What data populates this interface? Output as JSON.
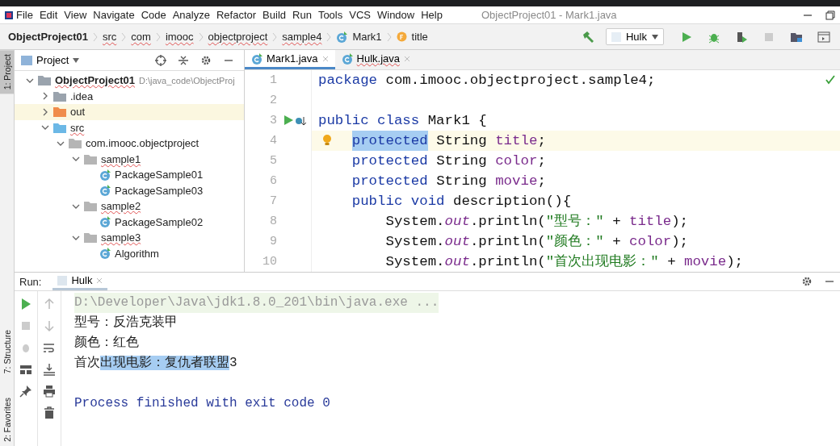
{
  "window": {
    "title": "ObjectProject01 - Mark1.java"
  },
  "menu": [
    "File",
    "Edit",
    "View",
    "Navigate",
    "Code",
    "Analyze",
    "Refactor",
    "Build",
    "Run",
    "Tools",
    "VCS",
    "Window",
    "Help"
  ],
  "breadcrumbs": [
    {
      "label": "ObjectProject01",
      "kind": "project"
    },
    {
      "label": "src",
      "kind": "dir"
    },
    {
      "label": "com",
      "kind": "dir"
    },
    {
      "label": "imooc",
      "kind": "dir"
    },
    {
      "label": "objectproject",
      "kind": "dir"
    },
    {
      "label": "sample4",
      "kind": "dir"
    },
    {
      "label": "Mark1",
      "kind": "class"
    },
    {
      "label": "title",
      "kind": "field"
    }
  ],
  "run_config": {
    "label": "Hulk"
  },
  "side_tabs": [
    {
      "label": "1: Project",
      "selected": true
    },
    {
      "label": "7: Structure",
      "selected": false
    },
    {
      "label": "2: Favorites",
      "selected": false
    }
  ],
  "project_panel": {
    "title": "Project",
    "tree": [
      {
        "label": "ObjectProject01",
        "path": "D:\\java_code\\ObjectProj",
        "kind": "module",
        "expanded": true,
        "selected": false,
        "children": [
          {
            "label": ".idea",
            "kind": "folder",
            "expanded": false,
            "selected": false
          },
          {
            "label": "out",
            "kind": "excluded",
            "expanded": false,
            "selected": true
          },
          {
            "label": "src",
            "kind": "source",
            "expanded": true,
            "selected": false,
            "children": [
              {
                "label": "com.imooc.objectproject",
                "kind": "package",
                "expanded": true,
                "selected": false,
                "children": [
                  {
                    "label": "sample1",
                    "kind": "package",
                    "expanded": true,
                    "selected": false,
                    "children": [
                      {
                        "label": "PackageSample01",
                        "kind": "class",
                        "selected": false
                      },
                      {
                        "label": "PackageSample03",
                        "kind": "class",
                        "selected": false
                      }
                    ]
                  },
                  {
                    "label": "sample2",
                    "kind": "package",
                    "expanded": true,
                    "selected": false,
                    "children": [
                      {
                        "label": "PackageSample02",
                        "kind": "class",
                        "selected": false
                      }
                    ]
                  },
                  {
                    "label": "sample3",
                    "kind": "package",
                    "expanded": true,
                    "selected": false,
                    "children": [
                      {
                        "label": "Algorithm",
                        "kind": "class",
                        "selected": false
                      }
                    ]
                  }
                ]
              }
            ]
          }
        ]
      }
    ]
  },
  "editor_tabs": [
    {
      "label": "Mark1.java",
      "selected": true
    },
    {
      "label": "Hulk.java",
      "selected": false
    }
  ],
  "code": [
    {
      "number": "1",
      "kind": "plain",
      "current": false,
      "tokens": [
        {
          "text": "package ",
          "kind": "keyword"
        },
        {
          "text": "com.imooc.objectproject.sample4;",
          "kind": "plain"
        }
      ]
    },
    {
      "number": "2",
      "kind": "plain",
      "current": false
    },
    {
      "number": "3",
      "kind": "run",
      "current": false,
      "tokens": [
        {
          "text": "public class ",
          "kind": "keyword"
        },
        {
          "text": "Mark1 {",
          "kind": "plain"
        }
      ]
    },
    {
      "number": "4",
      "kind": "bulb",
      "current": true,
      "tokens": [
        {
          "text": "    protected",
          "kind": "selected"
        },
        {
          "text": " String ",
          "kind": "plain"
        },
        {
          "text": "title",
          "kind": "field"
        },
        {
          "text": ";",
          "kind": "plain"
        }
      ]
    },
    {
      "number": "5",
      "kind": "plain",
      "current": false,
      "tokens": [
        {
          "text": "    protected ",
          "kind": "keyword"
        },
        {
          "text": "String ",
          "kind": "plain"
        },
        {
          "text": "color",
          "kind": "field"
        },
        {
          "text": ";",
          "kind": "plain"
        }
      ]
    },
    {
      "number": "6",
      "kind": "plain",
      "current": false,
      "tokens": [
        {
          "text": "    protected ",
          "kind": "keyword"
        },
        {
          "text": "String ",
          "kind": "plain"
        },
        {
          "text": "movie",
          "kind": "field"
        },
        {
          "text": ";",
          "kind": "plain"
        }
      ]
    },
    {
      "number": "7",
      "kind": "plain",
      "current": false,
      "tokens": [
        {
          "text": "    public void ",
          "kind": "keyword"
        },
        {
          "text": "description(){",
          "kind": "plain"
        }
      ]
    },
    {
      "number": "8",
      "kind": "plain",
      "current": false,
      "tokens": [
        {
          "text": "        System.",
          "kind": "plain"
        },
        {
          "text": "out",
          "kind": "static"
        },
        {
          "text": ".println(",
          "kind": "plain"
        },
        {
          "text": "\"型号：\"",
          "kind": "string"
        },
        {
          "text": " + ",
          "kind": "plain"
        },
        {
          "text": "title",
          "kind": "field"
        },
        {
          "text": ");",
          "kind": "plain"
        }
      ]
    },
    {
      "number": "9",
      "kind": "plain",
      "current": false,
      "tokens": [
        {
          "text": "        System.",
          "kind": "plain"
        },
        {
          "text": "out",
          "kind": "static"
        },
        {
          "text": ".println(",
          "kind": "plain"
        },
        {
          "text": "\"颜色：\"",
          "kind": "string"
        },
        {
          "text": " + ",
          "kind": "plain"
        },
        {
          "text": "color",
          "kind": "field"
        },
        {
          "text": ");",
          "kind": "plain"
        }
      ]
    },
    {
      "number": "10",
      "kind": "plain",
      "current": false,
      "tokens": [
        {
          "text": "        System.",
          "kind": "plain"
        },
        {
          "text": "out",
          "kind": "static"
        },
        {
          "text": ".println(",
          "kind": "plain"
        },
        {
          "text": "\"首次出现电影：\"",
          "kind": "string"
        },
        {
          "text": " + ",
          "kind": "plain"
        },
        {
          "text": "movie",
          "kind": "field"
        },
        {
          "text": ");",
          "kind": "plain"
        }
      ]
    }
  ],
  "run_panel": {
    "label": "Run:",
    "tab": "Hulk",
    "console": [
      {
        "kind": "command",
        "segments": [
          {
            "text": "D:\\Developer\\Java\\jdk1.8.0_201\\bin\\java.exe ...",
            "selected": false
          }
        ]
      },
      {
        "kind": "output",
        "segments": [
          {
            "text": "型号：反浩克装甲",
            "selected": false
          }
        ]
      },
      {
        "kind": "output",
        "segments": [
          {
            "text": "颜色：红色",
            "selected": false
          }
        ]
      },
      {
        "kind": "output",
        "segments": [
          {
            "text": "首次",
            "selected": false
          },
          {
            "text": "出现电影：复仇者联盟",
            "selected": true
          },
          {
            "text": "3",
            "selected": false
          }
        ]
      },
      {
        "kind": "blank"
      },
      {
        "kind": "exit",
        "segments": [
          {
            "text": "Process finished with exit code 0",
            "selected": false
          }
        ]
      }
    ]
  }
}
